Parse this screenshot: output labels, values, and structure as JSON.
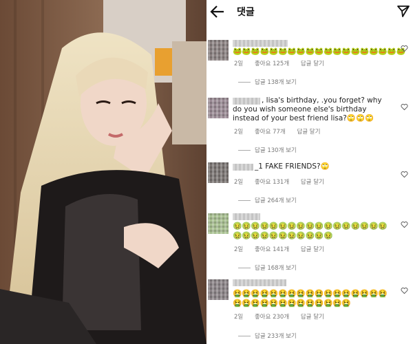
{
  "header": {
    "title": "댓글",
    "back_icon": "arrow-left-icon",
    "send_icon": "paper-plane-icon"
  },
  "comments": [
    {
      "text": "",
      "emoji": "🐸🐸🐸🐸🐸🐸🐸🐸🐸🐸🐸🐸🐸🐸🐸🐸🐸🐸🐸",
      "time": "2일",
      "likes": "좋아요 125개",
      "reply": "답글 달기",
      "view_replies": "답글 138개 보기",
      "avatar_color": "#8a8080"
    },
    {
      "text": ", lisa's birthday, .you forget?  why do you wish someone else's birthday instead of your best friend lisa?🙄🙄🙄",
      "emoji": "",
      "time": "2일",
      "likes": "좋아요 77개",
      "reply": "답글 달기",
      "view_replies": "답글 130개 보기",
      "avatar_color": "#9a8a94"
    },
    {
      "text": "_1 FAKE FRIENDS?🙄",
      "emoji": "",
      "time": "2일",
      "likes": "좋아요 131개",
      "reply": "답글 달기",
      "view_replies": "답글 264개 보기",
      "avatar_color": "#7a7472"
    },
    {
      "text": "",
      "emoji": "🤢🤢🤢🤢🤢🤢🤢🤢🤢🤢🤢🤢🤢🤢🤢🤢🤢🤢🤢🤢🤢🤢🤢🤢🤢🤢🤢🤢",
      "time": "2일",
      "likes": "좋아요 141개",
      "reply": "답글 달기",
      "view_replies": "답글 168개 보기",
      "avatar_color": "#a8c090"
    },
    {
      "text": "",
      "emoji": "🤮🤮🤮🤮🤮🤮🤮🤮🤮🤮🤮🤮🤮🤮🤮🤮🤮🤮🤮🤮🤮🤮🤮🤮🤮🤮🤮🤮🤮🤮",
      "time": "2일",
      "likes": "좋아요 230개",
      "reply": "답글 달기",
      "view_replies": "답글 233개 보기",
      "avatar_color": "#8a8286"
    }
  ],
  "colors": {
    "text": "#222222",
    "meta": "#777777",
    "header": "#111111"
  }
}
